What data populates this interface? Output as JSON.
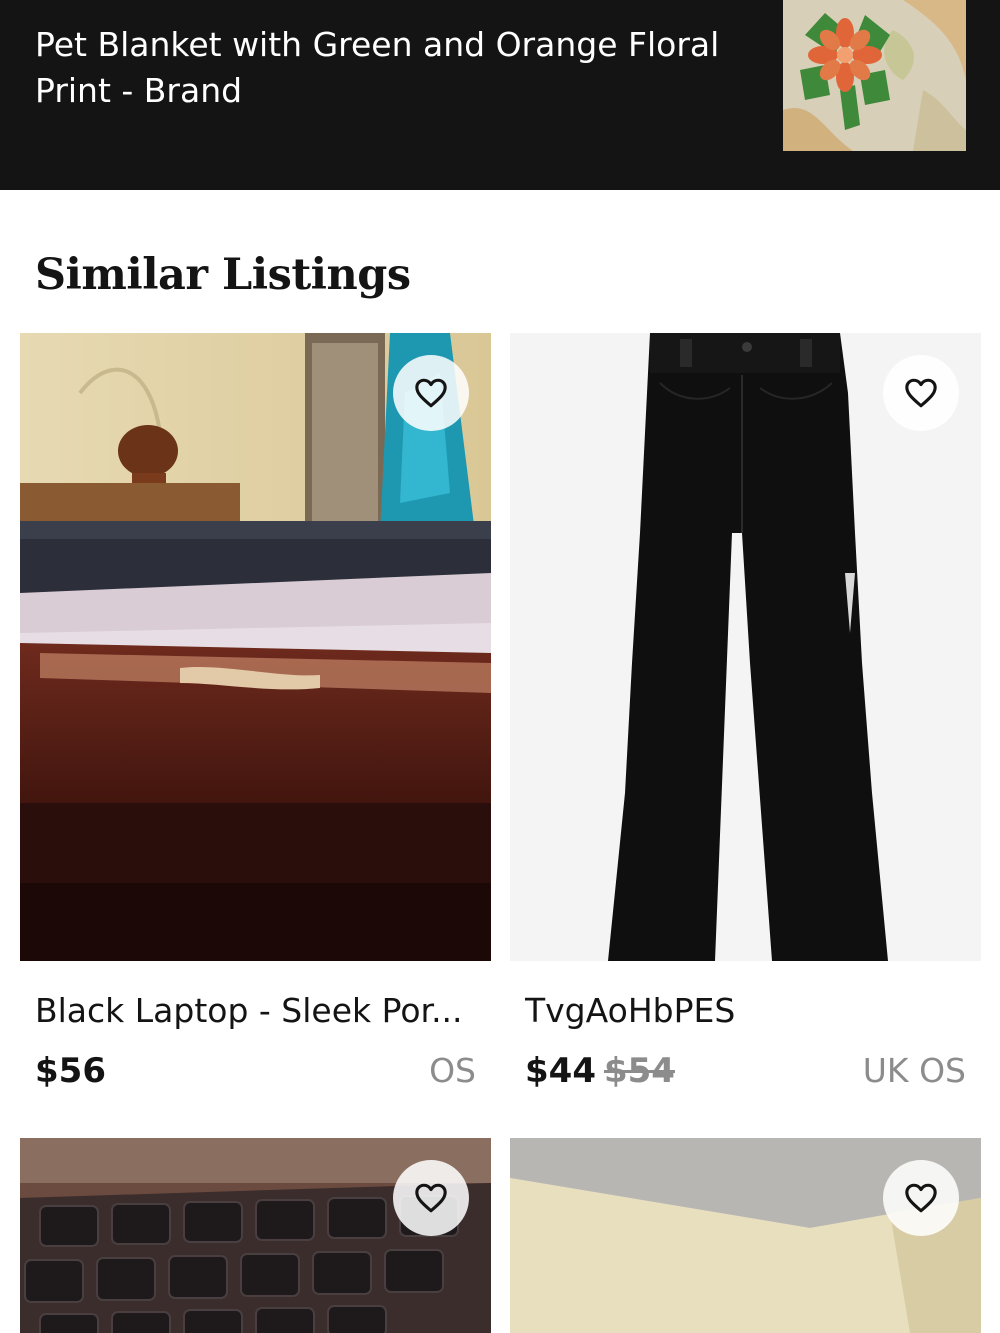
{
  "header": {
    "title": "Pet Blanket with Green and Orange Floral Print - Brand"
  },
  "section": {
    "title": "Similar Listings"
  },
  "listings": [
    {
      "name": "Black Laptop - Sleek Por...",
      "price": "$56",
      "original_price": "",
      "size": "OS"
    },
    {
      "name": "TvgAoHbPES",
      "price": "$44",
      "original_price": "$54",
      "size": "UK OS"
    },
    {
      "name": "",
      "price": "",
      "original_price": "",
      "size": ""
    },
    {
      "name": "",
      "price": "",
      "original_price": "",
      "size": ""
    }
  ],
  "icons": {
    "like": "heart-outline-icon"
  },
  "colors": {
    "header_bg": "#141414",
    "text_primary": "#141414",
    "text_muted": "#8c8c8c"
  }
}
